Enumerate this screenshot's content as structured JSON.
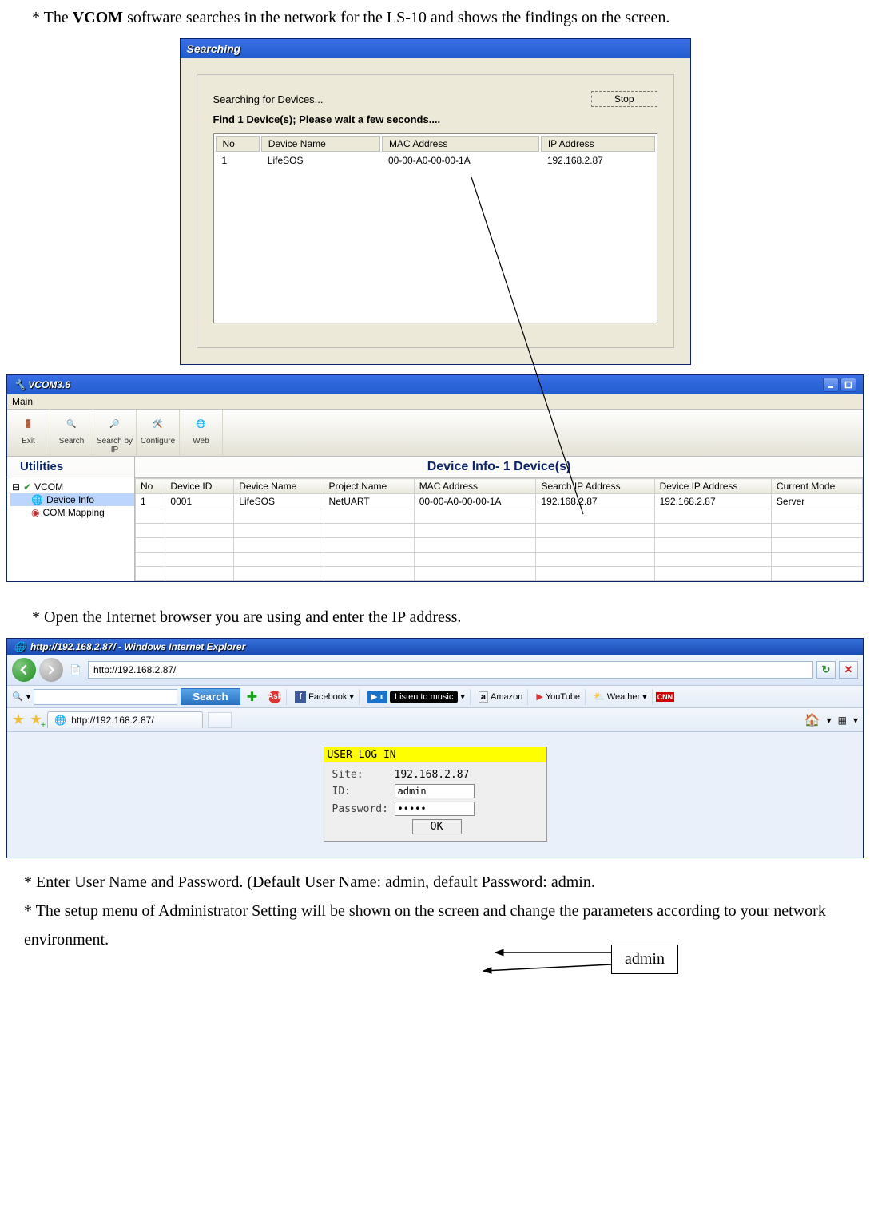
{
  "intro": {
    "prefix": "* The ",
    "vcom": "VCOM",
    "rest": " software searches in the network for the LS-10 and shows the findings on the screen."
  },
  "searching": {
    "title": "Searching",
    "label": "Searching for  Devices...",
    "stop": "Stop",
    "status": "Find 1 Device(s);  Please wait a few seconds....",
    "columns": [
      "No",
      "Device Name",
      "MAC Address",
      "IP Address"
    ],
    "row": {
      "no": "1",
      "name": "LifeSOS",
      "mac": "00-00-A0-00-00-1A",
      "ip": "192.168.2.87"
    }
  },
  "vcom": {
    "title": "VCOM3.6",
    "menu": "Main",
    "toolbar": [
      "Exit",
      "Search",
      "Search by IP",
      "Configure",
      "Web"
    ],
    "utilities": "Utilities",
    "tree": {
      "root": "VCOM",
      "items": [
        "Device Info",
        "COM Mapping"
      ]
    },
    "right_header": "Device Info- 1 Device(s)",
    "columns": [
      "No",
      "Device ID",
      "Device Name",
      "Project Name",
      "MAC Address",
      "Search IP Address",
      "Device IP Address",
      "Current Mode"
    ],
    "row": {
      "no": "1",
      "id": "0001",
      "name": "LifeSOS",
      "proj": "NetUART",
      "mac": "00-00-A0-00-00-1A",
      "sip": "192.168.2.87",
      "dip": "192.168.2.87",
      "mode": "Server"
    }
  },
  "step2": "* Open the Internet browser you are using and enter the IP address.",
  "ie": {
    "title": "http://192.168.2.87/ -  Windows Internet Explorer",
    "url": "http://192.168.2.87/",
    "search_btn": "Search",
    "toolbar_items": {
      "fb": "Facebook",
      "music": "Listen to music",
      "amazon": "Amazon",
      "youtube": "YouTube",
      "weather": "Weather"
    },
    "tab": "http://192.168.2.87/",
    "login": {
      "title": "USER LOG IN",
      "site_label": "Site:",
      "site": "192.168.2.87",
      "id_label": "ID:",
      "id": "admin",
      "pw_label": "Password:",
      "pw": "•••••",
      "ok": "OK"
    }
  },
  "callout": {
    "admin": "admin"
  },
  "final": {
    "l1a": "* Enter User Name and Password. (Default User Name: ",
    "l1b": "admin",
    "l1c": ", default Password: ",
    "l1d": "admin.",
    "l2a": "* The setup menu of ",
    "l2b": "Administrator Setting",
    "l2c": " will be shown on the screen and change the parameters according to your network environment."
  }
}
